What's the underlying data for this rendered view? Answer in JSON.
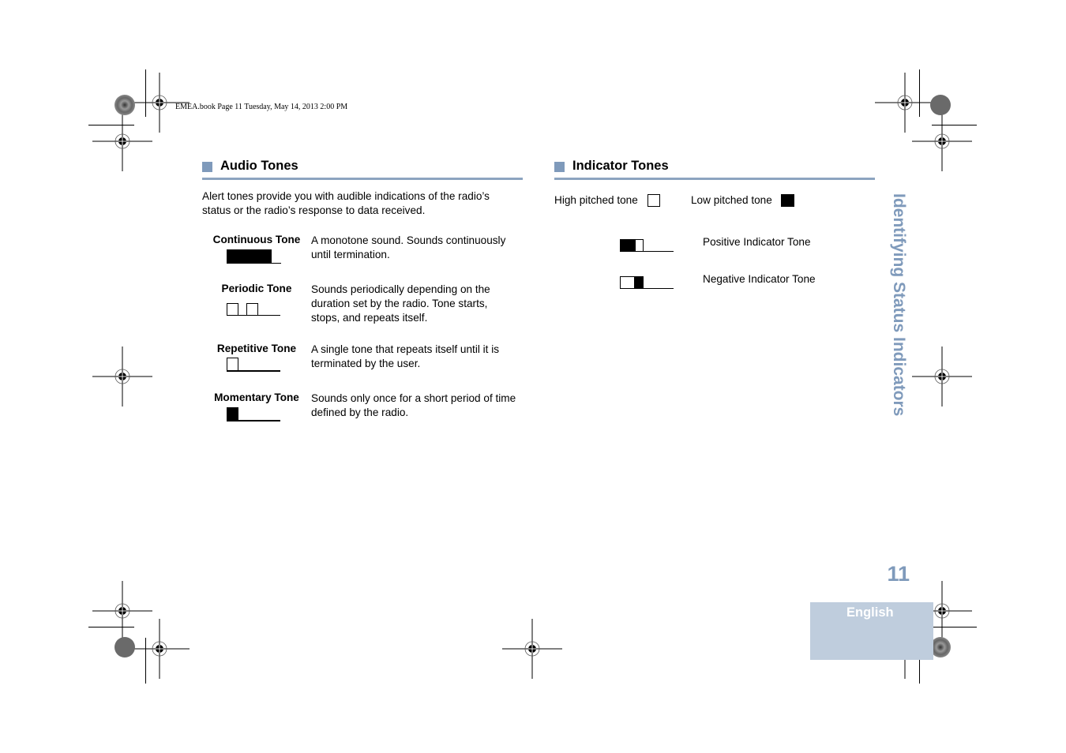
{
  "header": {
    "print_info": "EMEA.book  Page 11  Tuesday, May 14, 2013  2:00 PM"
  },
  "audio_tones": {
    "title": "Audio Tones",
    "intro": "Alert tones provide you with audible indications of the radio’s status or the radio’s response to data received.",
    "tones": [
      {
        "label": "Continuous Tone",
        "description": "A monotone sound. Sounds continuously until termination.",
        "pattern": "continuous"
      },
      {
        "label": "Periodic Tone",
        "description": "Sounds periodically depending on the duration set by the radio. Tone starts, stops, and repeats itself.",
        "pattern": "periodic"
      },
      {
        "label": "Repetitive Tone",
        "description": "A single tone that repeats itself until it is terminated by the user.",
        "pattern": "repetitive"
      },
      {
        "label": "Momentary Tone",
        "description": "Sounds only once for a short period of time defined by the radio.",
        "pattern": "momentary"
      }
    ]
  },
  "indicator_tones": {
    "title": "Indicator Tones",
    "legend": {
      "high": "High pitched tone",
      "low": "Low pitched tone"
    },
    "items": [
      {
        "label": "Positive Indicator Tone",
        "pattern": "low-then-high"
      },
      {
        "label": "Negative Indicator Tone",
        "pattern": "high-then-low"
      }
    ]
  },
  "sidebar": {
    "chapter_title": "Identifying Status Indicators",
    "page_number": "11",
    "language_tab": "English"
  },
  "colors": {
    "accent": "#7f9abb",
    "rule": "#8ca4c0",
    "language_tab_bg": "#bfcddd"
  }
}
